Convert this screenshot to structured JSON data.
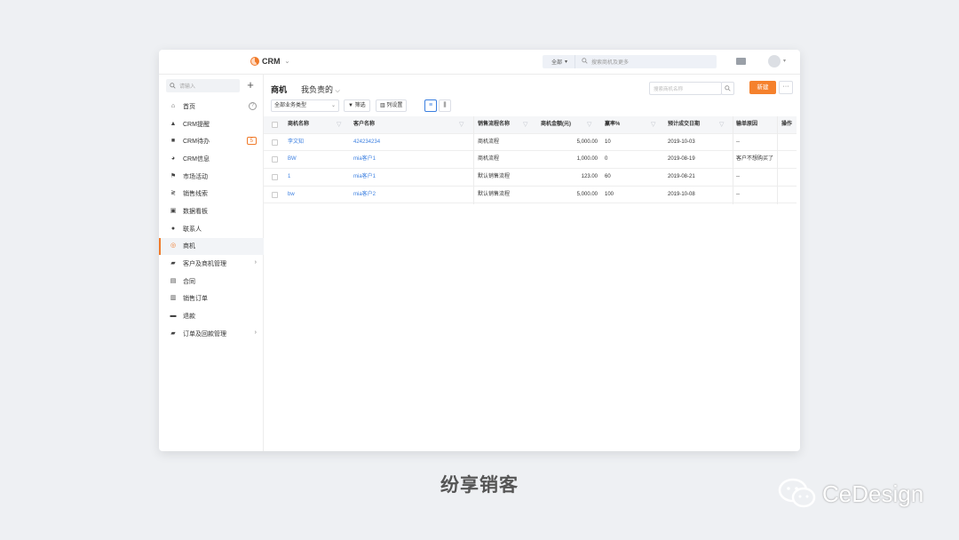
{
  "app": {
    "name": "CRM",
    "global_scope": "全部",
    "global_search_placeholder": "搜索商机及更多"
  },
  "sidebar": {
    "search_placeholder": "请输入",
    "items": [
      {
        "label": "首页",
        "icon": "home-icon"
      },
      {
        "label": "CRM提醒",
        "icon": "bell-icon"
      },
      {
        "label": "CRM待办",
        "icon": "clipboard-icon",
        "badge": "5"
      },
      {
        "label": "CRM信息",
        "icon": "pie-icon"
      },
      {
        "label": "市场活动",
        "icon": "flag-icon"
      },
      {
        "label": "销售线索",
        "icon": "lead-icon"
      },
      {
        "label": "数据看板",
        "icon": "board-icon"
      },
      {
        "label": "联系人",
        "icon": "person-icon"
      },
      {
        "label": "商机",
        "icon": "target-icon",
        "active": true
      },
      {
        "label": "客户及商机管理",
        "icon": "folder-icon",
        "expand": true
      },
      {
        "label": "合同",
        "icon": "document-icon"
      },
      {
        "label": "销售订单",
        "icon": "order-icon"
      },
      {
        "label": "退款",
        "icon": "refund-icon"
      },
      {
        "label": "订单及回款管理",
        "icon": "folder-icon",
        "expand": true
      }
    ]
  },
  "main": {
    "title": "商机",
    "view_scope": "我负责的",
    "search_placeholder": "搜索商机名称",
    "new_button": "新建",
    "more_button": "···",
    "business_type": "全部业务类型",
    "filter_button": "筛选",
    "columns_button": "列设置"
  },
  "table": {
    "headers": [
      "商机名称",
      "客户名称",
      "销售流程名称",
      "商机金额(元)",
      "赢率%",
      "预计成交日期",
      "输单原因",
      "操作"
    ],
    "rows": [
      {
        "name": "李文知",
        "customer": "424234234",
        "process": "商机流程",
        "amount": "5,000.00",
        "rate": "10",
        "date": "2019-10-03",
        "reason": "--"
      },
      {
        "name": "BW",
        "customer": "mia客户1",
        "process": "商机流程",
        "amount": "1,000.00",
        "rate": "0",
        "date": "2019-08-19",
        "reason": "客户不想购买了"
      },
      {
        "name": "1",
        "customer": "mia客户1",
        "process": "默认销售流程",
        "amount": "123.00",
        "rate": "60",
        "date": "2019-08-21",
        "reason": "--"
      },
      {
        "name": "bw",
        "customer": "mia客户2",
        "process": "默认销售流程",
        "amount": "5,000.00",
        "rate": "100",
        "date": "2019-10-08",
        "reason": "--"
      }
    ]
  },
  "caption": "纷享销客",
  "watermark": "CeDesign",
  "colors": {
    "accent": "#f5812d",
    "link": "#3b7fe0"
  }
}
